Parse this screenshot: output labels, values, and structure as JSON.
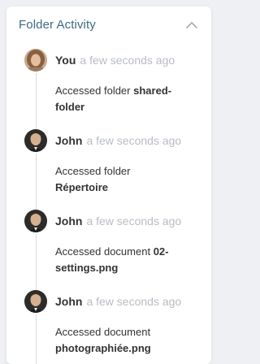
{
  "panel": {
    "title": "Folder Activity",
    "collapse_icon": "chevron-up-icon"
  },
  "entries": [
    {
      "user": "You",
      "time": "a few seconds ago",
      "action": "Accessed folder",
      "target": "shared-folder",
      "avatar": "woman-avatar"
    },
    {
      "user": "John",
      "time": "a few seconds ago",
      "action": "Accessed folder",
      "target": "Répertoire",
      "avatar": "man-avatar"
    },
    {
      "user": "John",
      "time": "a few seconds ago",
      "action": "Accessed document",
      "target": "02-settings.png",
      "avatar": "man-avatar"
    },
    {
      "user": "John",
      "time": "a few seconds ago",
      "action": "Accessed document",
      "target": "photographiée.png",
      "avatar": "man-avatar"
    }
  ],
  "colors": {
    "title": "#3d6a88",
    "timestamp": "#b8bcc2",
    "timeline": "#d8dce1"
  }
}
